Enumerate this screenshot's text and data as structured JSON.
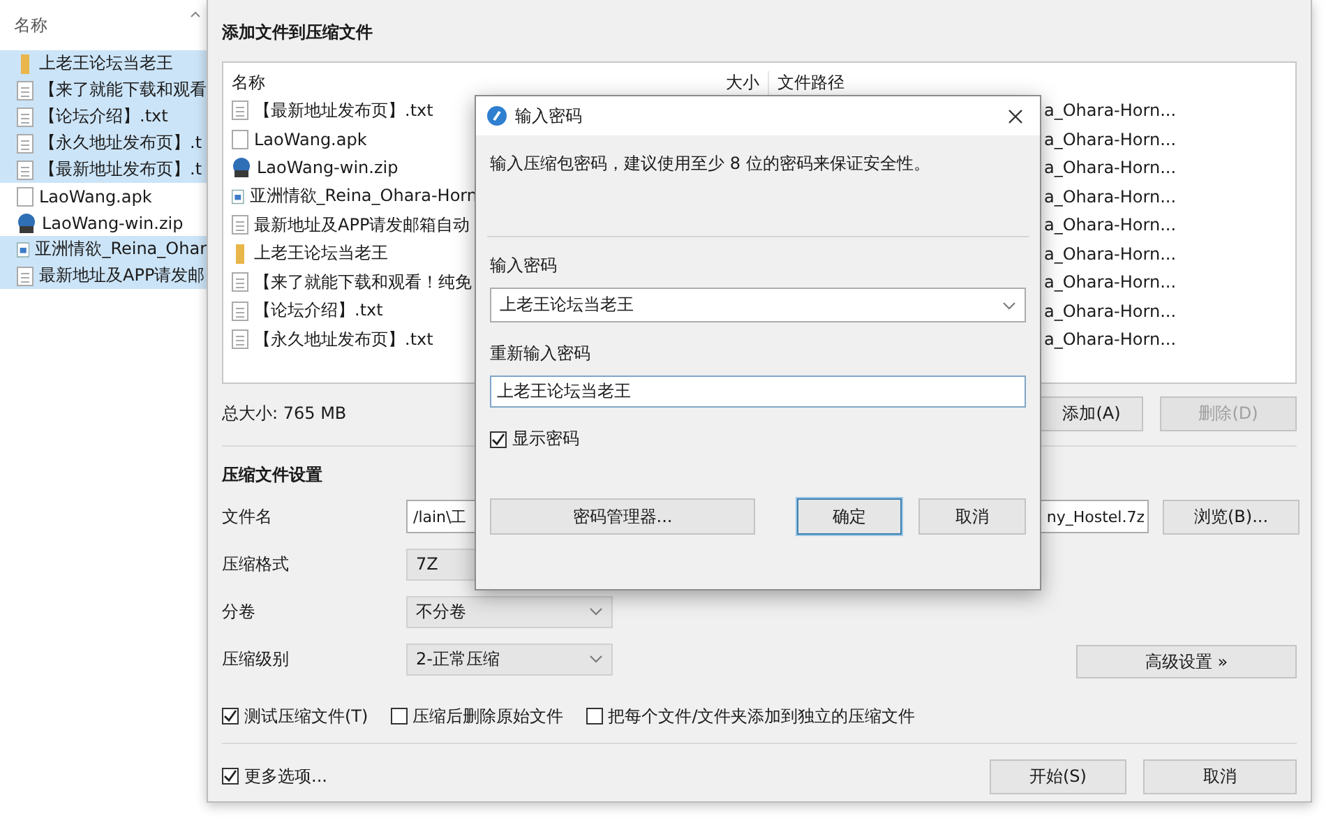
{
  "explorer": {
    "header": "名称",
    "items": [
      {
        "name": "上老王论坛当老王",
        "kind": "folder",
        "selected": true
      },
      {
        "name": "【来了就能下载和观看",
        "kind": "txt",
        "selected": true
      },
      {
        "name": "【论坛介绍】.txt",
        "kind": "txt",
        "selected": true
      },
      {
        "name": "【永久地址发布页】.t",
        "kind": "txt",
        "selected": true
      },
      {
        "name": "【最新地址发布页】.t",
        "kind": "txt",
        "selected": true
      },
      {
        "name": "LaoWang.apk",
        "kind": "file",
        "selected": false
      },
      {
        "name": "LaoWang-win.zip",
        "kind": "zip",
        "selected": false
      },
      {
        "name": "亚洲情欲_Reina_Ohar",
        "kind": "video",
        "selected": true
      },
      {
        "name": "最新地址及APP请发邮",
        "kind": "txt",
        "selected": true
      }
    ]
  },
  "window": {
    "title": "添加文件到压缩文件",
    "file_list": {
      "columns": [
        "名称",
        "大小",
        "文件路径"
      ],
      "rows": [
        {
          "name": "【最新地址发布页】.txt",
          "kind": "txt",
          "path": "a_Ohara-Horn..."
        },
        {
          "name": "LaoWang.apk",
          "kind": "file",
          "path": "a_Ohara-Horn..."
        },
        {
          "name": "LaoWang-win.zip",
          "kind": "zip",
          "path": "a_Ohara-Horn..."
        },
        {
          "name": "亚洲情欲_Reina_Ohara-Horn",
          "kind": "video",
          "path": "a_Ohara-Horn..."
        },
        {
          "name": "最新地址及APP请发邮箱自动",
          "kind": "txt",
          "path": "a_Ohara-Horn..."
        },
        {
          "name": "上老王论坛当老王",
          "kind": "folder",
          "path": "a_Ohara-Horn..."
        },
        {
          "name": "【来了就能下载和观看！纯免",
          "kind": "txt",
          "path": "a_Ohara-Horn..."
        },
        {
          "name": "【论坛介绍】.txt",
          "kind": "txt",
          "path": "a_Ohara-Horn..."
        },
        {
          "name": "【永久地址发布页】.txt",
          "kind": "txt",
          "path": "a_Ohara-Horn..."
        }
      ]
    },
    "total_size": "总大小: 765 MB",
    "add_button": {
      "label": "添加(A)",
      "disabled": false
    },
    "remove_button": {
      "label": "删除(D)",
      "disabled": true
    },
    "settings_title": "压缩文件设置",
    "filename": {
      "label": "文件名",
      "value_start": "/lain\\工",
      "value_end": "ny_Hostel.7z",
      "browse": "浏览(B)..."
    },
    "format": {
      "label": "压缩格式",
      "value": "7Z"
    },
    "split": {
      "label": "分卷",
      "value": "不分卷"
    },
    "level": {
      "label": "压缩级别",
      "value": "2-正常压缩"
    },
    "advanced_button": "高级设置 »",
    "options": [
      {
        "label": "测试压缩文件(T)",
        "checked": true
      },
      {
        "label": "压缩后删除原始文件",
        "checked": false
      },
      {
        "label": "把每个文件/文件夹添加到独立的压缩文件",
        "checked": false
      }
    ],
    "more_options": {
      "label": "更多选项...",
      "checked": true
    },
    "buttons": [
      "开始(S)",
      "取消"
    ]
  },
  "dialog": {
    "title": "输入密码",
    "message": "输入压缩包密码，建议使用至少 8 位的密码来保证安全性。",
    "password_label": "输入密码",
    "password": "上老王论坛当老王",
    "confirm_label": "重新输入密码",
    "confirm": "上老王论坛当老王",
    "show_password": {
      "label": "显示密码",
      "checked": true
    },
    "manager_button": "密码管理器...",
    "ok_button": "确定",
    "cancel_button": "取消"
  }
}
